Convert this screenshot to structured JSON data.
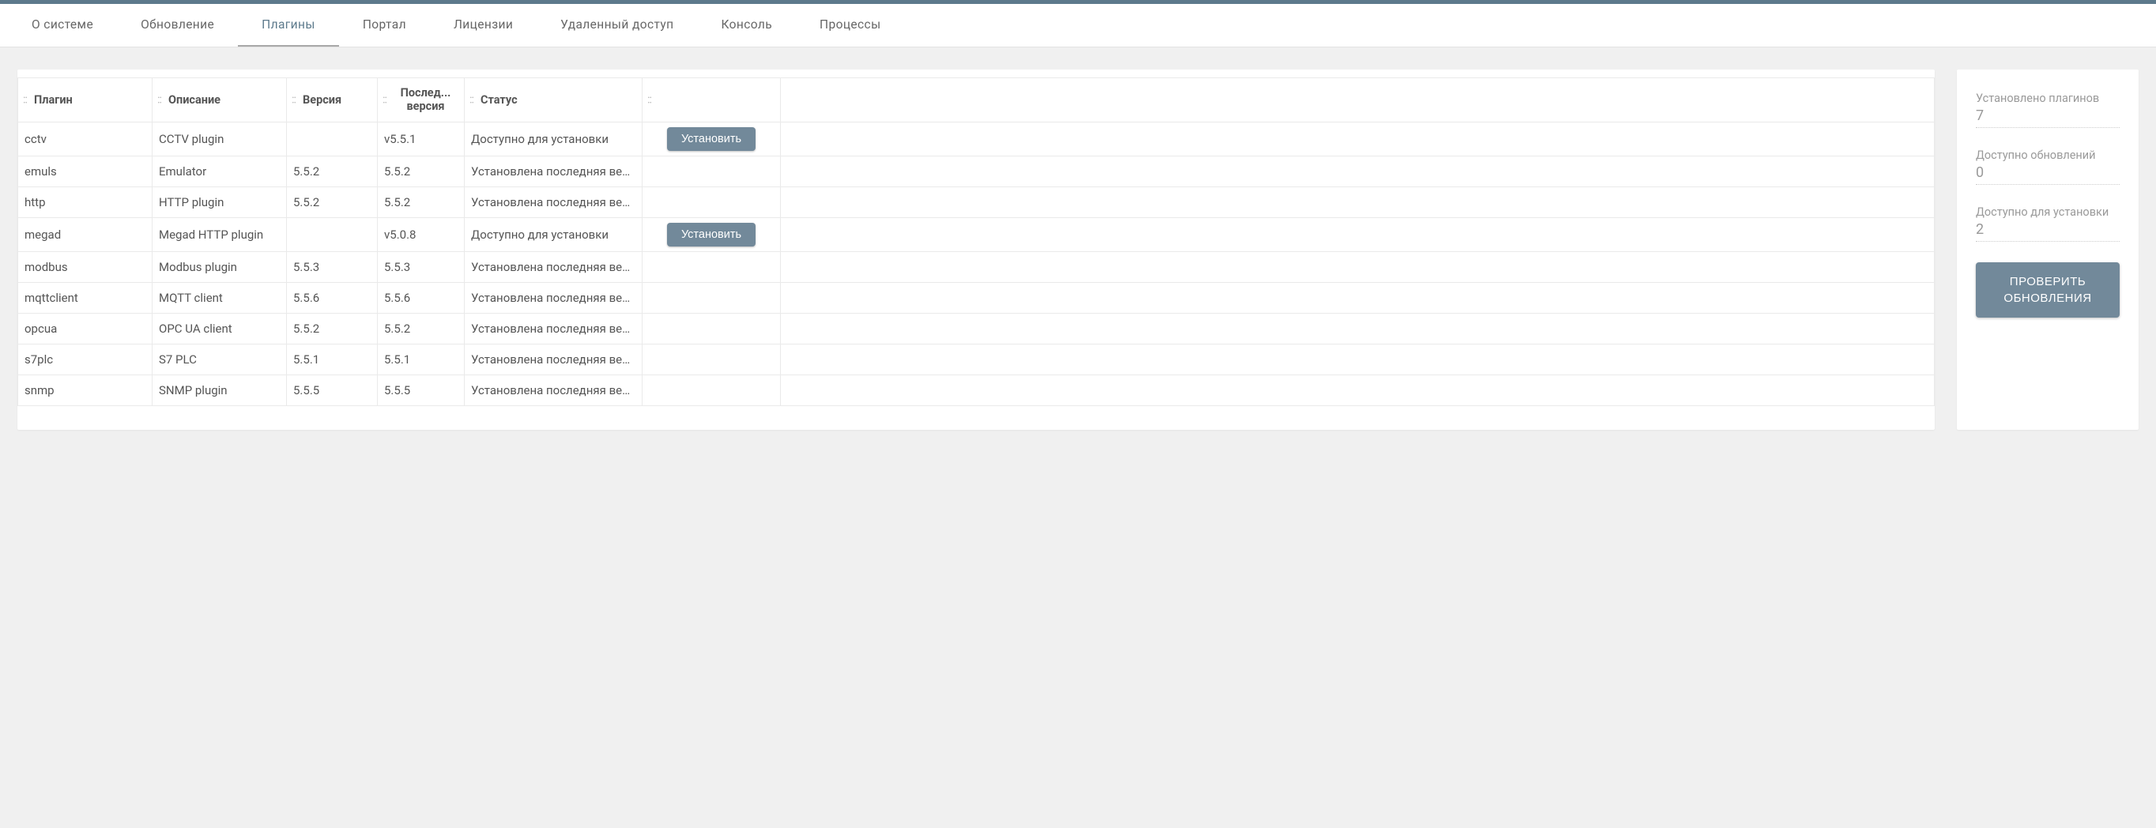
{
  "nav": {
    "items": [
      {
        "label": "О системе"
      },
      {
        "label": "Обновление"
      },
      {
        "label": "Плагины",
        "active": true
      },
      {
        "label": "Портал"
      },
      {
        "label": "Лицензии"
      },
      {
        "label": "Удаленный доступ"
      },
      {
        "label": "Консоль"
      },
      {
        "label": "Процессы"
      }
    ]
  },
  "table": {
    "headers": {
      "plugin": "Плагин",
      "description": "Описание",
      "version": "Версия",
      "last_version": "Послед... версия",
      "status": "Статус"
    },
    "install_label": "Установить",
    "rows": [
      {
        "plugin": "cctv",
        "description": "CCTV plugin",
        "version": "",
        "last_version": "v5.5.1",
        "status": "Доступно для установки",
        "installable": true
      },
      {
        "plugin": "emuls",
        "description": "Emulator",
        "version": "5.5.2",
        "last_version": "5.5.2",
        "status": "Установлена последняя вер...",
        "installable": false
      },
      {
        "plugin": "http",
        "description": "HTTP plugin",
        "version": "5.5.2",
        "last_version": "5.5.2",
        "status": "Установлена последняя вер...",
        "installable": false
      },
      {
        "plugin": "megad",
        "description": "Megad HTTP plugin",
        "version": "",
        "last_version": "v5.0.8",
        "status": "Доступно для установки",
        "installable": true
      },
      {
        "plugin": "modbus",
        "description": "Modbus plugin",
        "version": "5.5.3",
        "last_version": "5.5.3",
        "status": "Установлена последняя вер...",
        "installable": false
      },
      {
        "plugin": "mqttclient",
        "description": "MQTT client",
        "version": "5.5.6",
        "last_version": "5.5.6",
        "status": "Установлена последняя вер...",
        "installable": false
      },
      {
        "plugin": "opcua",
        "description": "OPC UA client",
        "version": "5.5.2",
        "last_version": "5.5.2",
        "status": "Установлена последняя вер...",
        "installable": false
      },
      {
        "plugin": "s7plc",
        "description": "S7 PLC",
        "version": "5.5.1",
        "last_version": "5.5.1",
        "status": "Установлена последняя вер...",
        "installable": false
      },
      {
        "plugin": "snmp",
        "description": "SNMP plugin",
        "version": "5.5.5",
        "last_version": "5.5.5",
        "status": "Установлена последняя вер...",
        "installable": false
      }
    ]
  },
  "sidebar": {
    "installed_label": "Установлено плагинов",
    "installed_value": "7",
    "updates_label": "Доступно обновлений",
    "updates_value": "0",
    "available_label": "Доступно для установки",
    "available_value": "2",
    "check_button": "ПРОВЕРИТЬ ОБНОВЛЕНИЯ"
  }
}
